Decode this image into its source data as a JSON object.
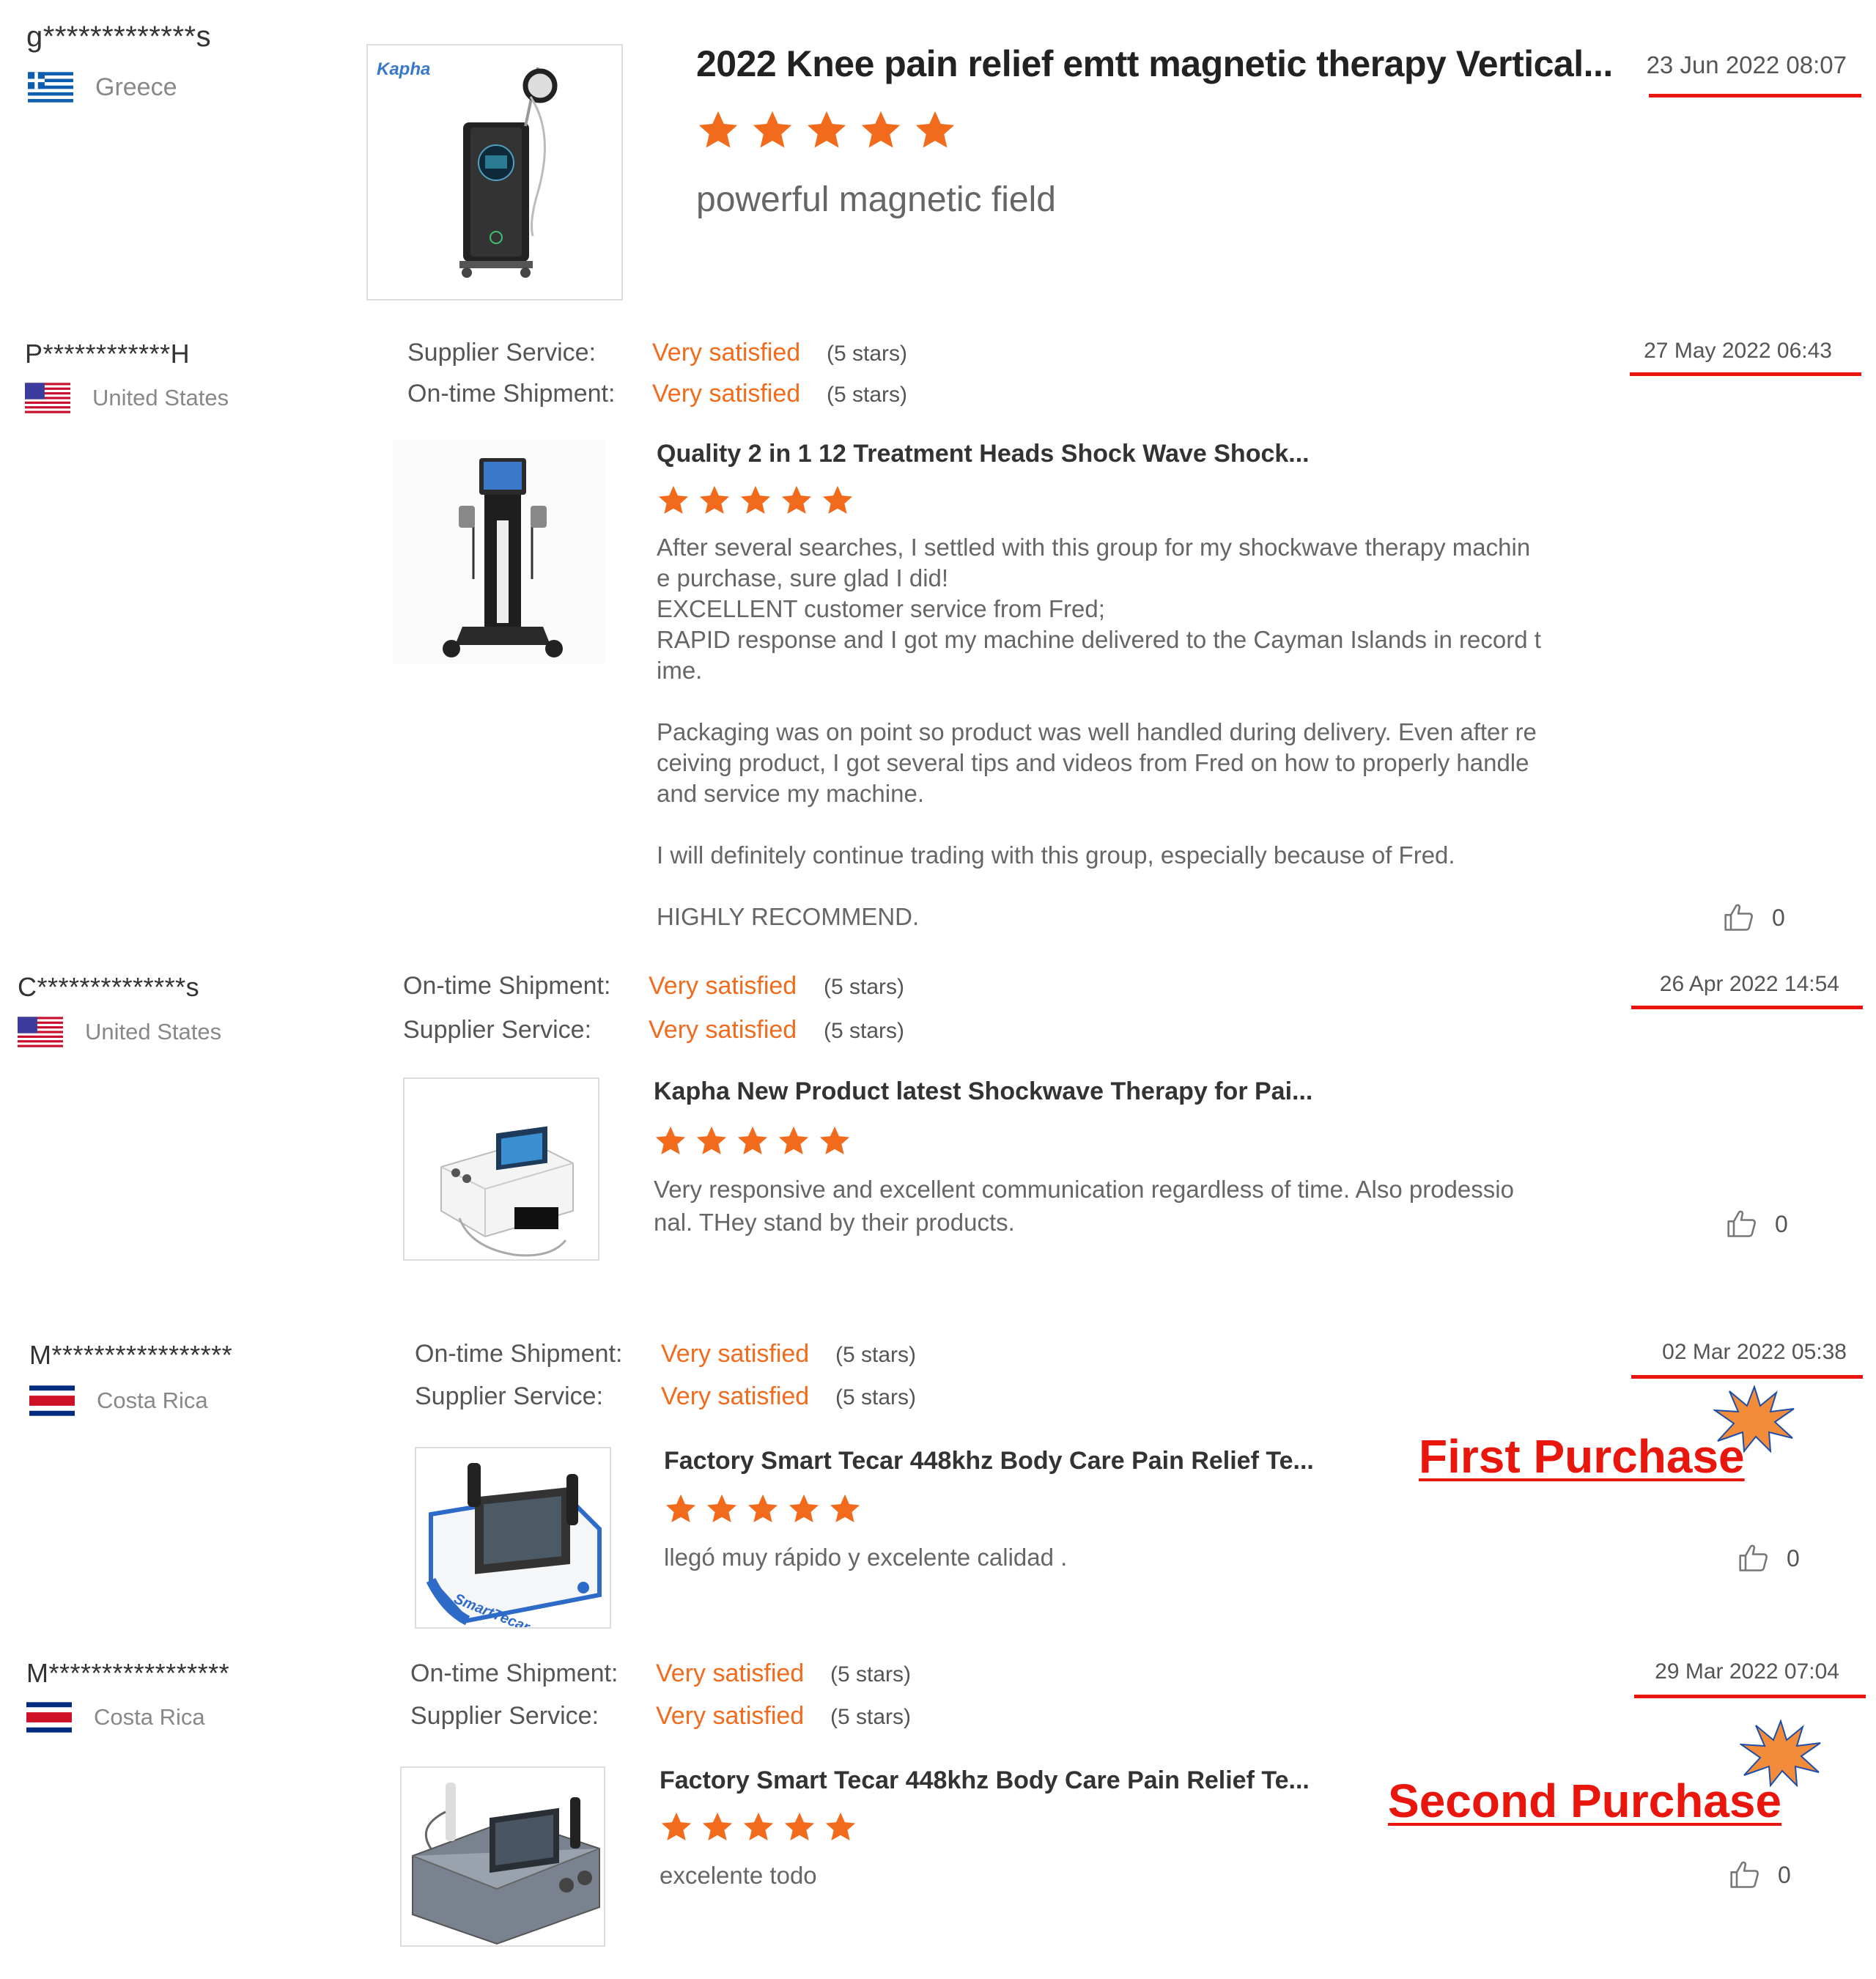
{
  "colors": {
    "accent_orange": "#f26b1d",
    "annotation_red": "#e8160c",
    "burst_fill": "#f28c3a",
    "burst_stroke": "#1f4ea8"
  },
  "reviews": [
    {
      "reviewer": "g*************s",
      "country": "Greece",
      "flag_icon": "greece-flag-icon",
      "date": "23 Jun 2022 08:07",
      "product": {
        "title": "2022 Knee pain relief emtt magnetic therapy Vertical...",
        "brand": "Kapha"
      },
      "rating": 5,
      "text": "powerful magnetic field"
    },
    {
      "reviewer": "P************H",
      "country": "United States",
      "flag_icon": "usa-flag-icon",
      "date": "27 May 2022 06:43",
      "ratings": [
        {
          "label": "Supplier Service:",
          "value": "Very satisfied",
          "stars": "(5 stars)"
        },
        {
          "label": "On-time Shipment:",
          "value": "Very satisfied",
          "stars": "(5 stars)"
        }
      ],
      "product": {
        "title": "Quality 2 in 1 12 Treatment Heads Shock Wave Shock..."
      },
      "rating": 5,
      "text": "After several searches, I settled with this group for my shockwave therapy machin\ne purchase, sure glad I did!\nEXCELLENT customer service from Fred;\nRAPID response and I got my machine delivered to the Cayman Islands in record t\nime.\n\nPackaging was on point so product was well handled during delivery. Even after re\nceiving product, I got several tips and videos from Fred on how to properly handle\nand service my machine.\n\nI will definitely continue trading with this group, especially because of Fred.\n\nHIGHLY RECOMMEND.",
      "likes": "0"
    },
    {
      "reviewer": "C**************s",
      "country": "United States",
      "flag_icon": "usa-flag-icon",
      "date": "26 Apr 2022 14:54",
      "ratings": [
        {
          "label": "On-time Shipment:",
          "value": "Very satisfied",
          "stars": "(5 stars)"
        },
        {
          "label": "Supplier Service:",
          "value": "Very satisfied",
          "stars": "(5 stars)"
        }
      ],
      "product": {
        "title": "Kapha New Product latest Shockwave Therapy for Pai..."
      },
      "rating": 5,
      "text": "Very responsive and excellent communication regardless of time. Also prodessio\nnal. THey stand by their products.",
      "likes": "0"
    },
    {
      "reviewer": "M*****************",
      "country": "Costa Rica",
      "flag_icon": "costa-rica-flag-icon",
      "date": "02 Mar 2022 05:38",
      "ratings": [
        {
          "label": "On-time Shipment:",
          "value": "Very satisfied",
          "stars": "(5 stars)"
        },
        {
          "label": "Supplier Service:",
          "value": "Very satisfied",
          "stars": "(5 stars)"
        }
      ],
      "product": {
        "title": "Factory Smart Tecar 448khz Body Care Pain Relief Te..."
      },
      "rating": 5,
      "text": "llegó muy rápido y excelente calidad .",
      "likes": "0",
      "annotation": "First Purchase"
    },
    {
      "reviewer": "M*****************",
      "country": "Costa Rica",
      "flag_icon": "costa-rica-flag-icon",
      "date": "29 Mar 2022 07:04",
      "ratings": [
        {
          "label": "On-time Shipment:",
          "value": "Very satisfied",
          "stars": "(5 stars)"
        },
        {
          "label": "Supplier Service:",
          "value": "Very satisfied",
          "stars": "(5 stars)"
        }
      ],
      "product": {
        "title": "Factory Smart Tecar 448khz Body Care Pain Relief Te..."
      },
      "rating": 5,
      "text": "excelente todo",
      "likes": "0",
      "annotation": "Second Purchase"
    }
  ]
}
